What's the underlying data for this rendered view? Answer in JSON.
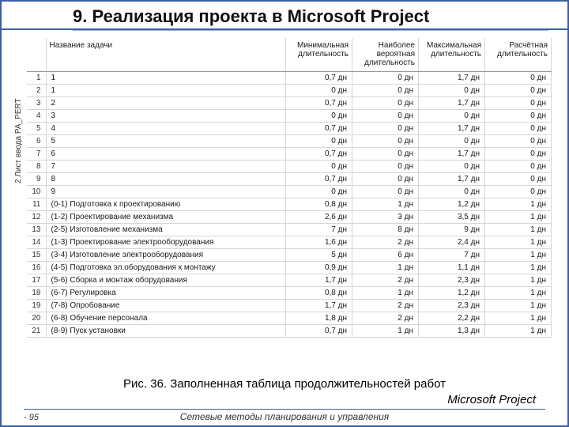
{
  "title": "9. Реализация проекта в Microsoft Project",
  "side_label": "2 Лист ввода PA_PERT",
  "columns": {
    "name": "Название задачи",
    "min": "Минимальная длительность",
    "likely": "Наиболее вероятная длительность",
    "max": "Максимальная длительность",
    "calc": "Расчётная длительность"
  },
  "rows": [
    {
      "n": "1",
      "name": "1",
      "min": "0,7 дн",
      "likely": "0 дн",
      "max": "1,7 дн",
      "calc": "0 дн"
    },
    {
      "n": "2",
      "name": "1",
      "min": "0 дн",
      "likely": "0 дн",
      "max": "0 дн",
      "calc": "0 дн"
    },
    {
      "n": "3",
      "name": "2",
      "min": "0,7 дн",
      "likely": "0 дн",
      "max": "1,7 дн",
      "calc": "0 дн"
    },
    {
      "n": "4",
      "name": "3",
      "min": "0 дн",
      "likely": "0 дн",
      "max": "0 дн",
      "calc": "0 дн"
    },
    {
      "n": "5",
      "name": "4",
      "min": "0,7 дн",
      "likely": "0 дн",
      "max": "1,7 дн",
      "calc": "0 дн"
    },
    {
      "n": "6",
      "name": "5",
      "min": "0 дн",
      "likely": "0 дн",
      "max": "0 дн",
      "calc": "0 дн"
    },
    {
      "n": "7",
      "name": "6",
      "min": "0,7 дн",
      "likely": "0 дн",
      "max": "1,7 дн",
      "calc": "0 дн"
    },
    {
      "n": "8",
      "name": "7",
      "min": "0 дн",
      "likely": "0 дн",
      "max": "0 дн",
      "calc": "0 дн"
    },
    {
      "n": "9",
      "name": "8",
      "min": "0,7 дн",
      "likely": "0 дн",
      "max": "1,7 дн",
      "calc": "0 дн"
    },
    {
      "n": "10",
      "name": "9",
      "min": "0 дн",
      "likely": "0 дн",
      "max": "0 дн",
      "calc": "0 дн"
    },
    {
      "n": "11",
      "name": "(0-1) Подготовка к проектированию",
      "min": "0,8 дн",
      "likely": "1 дн",
      "max": "1,2 дн",
      "calc": "1 дн"
    },
    {
      "n": "12",
      "name": "(1-2) Проектирование механизма",
      "min": "2,6 дн",
      "likely": "3 дн",
      "max": "3,5 дн",
      "calc": "1 дн"
    },
    {
      "n": "13",
      "name": "(2-5) Изготовление механизма",
      "min": "7 дн",
      "likely": "8 дн",
      "max": "9 дн",
      "calc": "1 дн"
    },
    {
      "n": "14",
      "name": "(1-3) Проектирование электрооборудования",
      "min": "1,6 дн",
      "likely": "2 дн",
      "max": "2,4 дн",
      "calc": "1 дн"
    },
    {
      "n": "15",
      "name": "(3-4) Изготовление электрооборудования",
      "min": "5 дн",
      "likely": "6 дн",
      "max": "7 дн",
      "calc": "1 дн"
    },
    {
      "n": "16",
      "name": "(4-5) Подготовка эл.оборудования к монтажу",
      "min": "0,9 дн",
      "likely": "1 дн",
      "max": "1,1 дн",
      "calc": "1 дн"
    },
    {
      "n": "17",
      "name": "(5-6) Сборка и монтаж оборудования",
      "min": "1,7 дн",
      "likely": "2 дн",
      "max": "2,3 дн",
      "calc": "1 дн"
    },
    {
      "n": "18",
      "name": "(6-7) Регулировка",
      "min": "0,8 дн",
      "likely": "1 дн",
      "max": "1,2 дн",
      "calc": "1 дн"
    },
    {
      "n": "19",
      "name": "(7-8) Опробование",
      "min": "1,7 дн",
      "likely": "2 дн",
      "max": "2,3 дн",
      "calc": "1 дн"
    },
    {
      "n": "20",
      "name": "(6-8) Обучение персонала",
      "min": "1,8 дн",
      "likely": "2 дн",
      "max": "2,2 дн",
      "calc": "1 дн"
    },
    {
      "n": "21",
      "name": "(8-9) Пуск установки",
      "min": "0,7 дн",
      "likely": "1 дн",
      "max": "1,3 дн",
      "calc": "1 дн"
    }
  ],
  "caption": "Рис. 36. Заполненная таблица продолжительностей работ",
  "caption_sub": "Microsoft Project",
  "footer_text": "Сетевые методы планирования и управления",
  "page_num": "- 95"
}
